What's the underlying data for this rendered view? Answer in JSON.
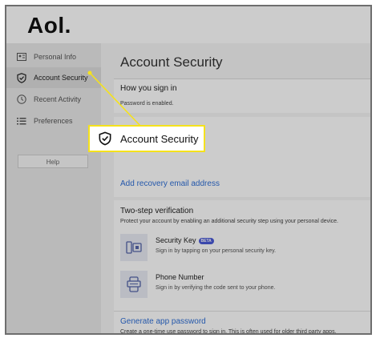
{
  "header": {
    "logo": "Aol."
  },
  "sidebar": {
    "items": [
      {
        "label": "Personal Info",
        "icon": "id-card-icon"
      },
      {
        "label": "Account Security",
        "icon": "shield-check-icon"
      },
      {
        "label": "Recent Activity",
        "icon": "clock-icon"
      },
      {
        "label": "Preferences",
        "icon": "list-icon"
      }
    ],
    "help_label": "Help"
  },
  "main": {
    "title": "Account Security",
    "sign_in": {
      "heading": "How you sign in",
      "status": "Password is enabled."
    },
    "recovery_link": "Add recovery email address",
    "two_step": {
      "heading": "Two-step verification",
      "description": "Protect your account by enabling an additional security step using your personal device.",
      "methods": [
        {
          "title": "Security Key",
          "badge": "BETA",
          "description": "Sign in by tapping on your personal security key.",
          "icon": "security-key-icon"
        },
        {
          "title": "Phone Number",
          "description": "Sign in by verifying the code sent to your phone.",
          "icon": "phone-icon"
        }
      ]
    },
    "app_password": {
      "link": "Generate app password",
      "description": "Create a one-time use password to sign in. This is often used for older third party apps."
    }
  },
  "callout": {
    "label": "Account Security",
    "icon": "shield-check-icon"
  },
  "colors": {
    "highlight": "#f5e21c",
    "link": "#2f6fd6",
    "overlay": "rgba(0,0,0,0.20)"
  }
}
